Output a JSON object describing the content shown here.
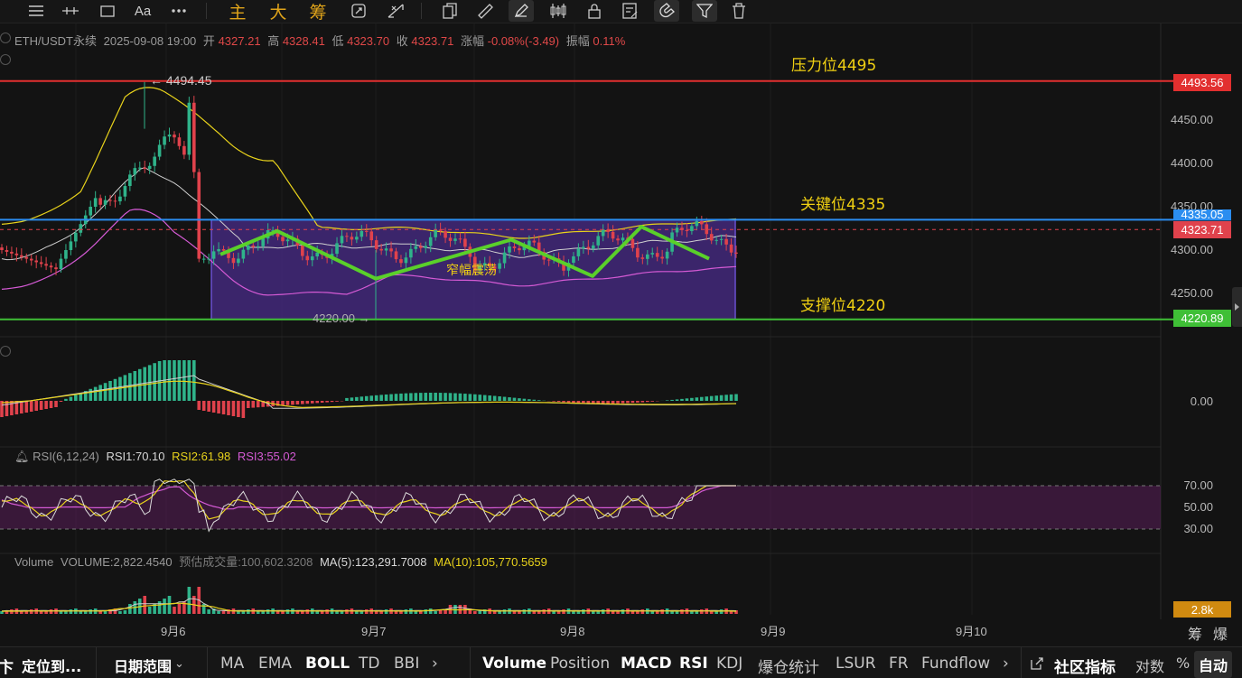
{
  "toolbar": {
    "icons": [
      "menu-icon",
      "horizontal-line-icon",
      "rectangle-icon",
      "text-icon",
      "more-icon",
      "copy-icon",
      "ruler-icon",
      "brush-icon",
      "candles-icon",
      "lock-icon",
      "note-icon",
      "magnet-icon",
      "filter-icon",
      "trash-icon"
    ],
    "text_tool": "Aa",
    "cn_buttons": [
      "主",
      "大",
      "筹"
    ]
  },
  "info": {
    "symbol": "ETH/USDT永续",
    "datetime": "2025-09-08 19:00",
    "open_label": "开",
    "open": "4327.21",
    "high_label": "高",
    "high": "4328.41",
    "low_label": "低",
    "low": "4323.70",
    "close_label": "收",
    "close": "4323.71",
    "change_label": "涨幅",
    "change": "-0.08%(-3.49)",
    "amp_label": "振幅",
    "amp": "0.11%"
  },
  "annotations": {
    "resistance": "压力位4495",
    "key": "关键位4335",
    "support": "支撑位4220",
    "range": "窄幅震荡",
    "high_mark": "← 4494.45",
    "low_mark": "4220.00 →"
  },
  "price_tags": {
    "resistance": "4493.56",
    "key": "4335.05",
    "current": "4323.71",
    "support": "4220.89",
    "volume": "2.8k"
  },
  "colors": {
    "resistance": "#e22f2f",
    "key": "#2b8df0",
    "support": "#3fbf36",
    "up": "#2fb38a",
    "down": "#e0424c",
    "box": "#4a2c8a",
    "annotation": "#f0d012"
  },
  "price_axis": [
    "4450.00",
    "4400.00",
    "4350.00",
    "4300.00",
    "4250.00"
  ],
  "macd_axis": [
    "0.00"
  ],
  "rsi_axis": [
    "70.00",
    "50.00",
    "30.00"
  ],
  "rsi": {
    "title": "RSI(6,12,24)",
    "rsi1": "RSI1:70.10",
    "rsi2": "RSI2:61.98",
    "rsi3": "RSI3:55.02"
  },
  "volume": {
    "title": "Volume",
    "vol": "VOLUME:2,822.4540",
    "est": "预估成交量:100,602.3208",
    "ma5": "MA(5):123,291.7008",
    "ma10": "MA(10):105,770.5659"
  },
  "dates": [
    "9月6",
    "9月7",
    "9月8",
    "9月9",
    "9月10"
  ],
  "corner": {
    "left": "筹",
    "right": "爆"
  },
  "bottom_bar": {
    "left_items": [
      "定位到...",
      "日期范围"
    ],
    "indicators_main": [
      "MA",
      "EMA",
      "BOLL",
      "TD",
      "BBI"
    ],
    "indicators_sub": [
      "Volume",
      "Position",
      "MACD",
      "RSI",
      "KDJ",
      "爆仓统计",
      "LSUR",
      "FR",
      "Fundflow"
    ],
    "community": "社区指标",
    "log": "对数",
    "pct": "%",
    "auto": "自动",
    "arrow": "›"
  },
  "chart_data": {
    "type": "candlestick",
    "symbol": "ETH/USDT永续",
    "x": [
      "9月6",
      "9月7",
      "9月8",
      "9月9",
      "9月10"
    ],
    "ylim": [
      4205,
      4510
    ],
    "levels": {
      "resistance": 4495,
      "key": 4335,
      "support": 4220
    },
    "range_box": {
      "top": 4335,
      "bottom": 4220
    },
    "last_close": 4323.71,
    "rsi_levels": [
      70,
      50,
      30
    ]
  }
}
